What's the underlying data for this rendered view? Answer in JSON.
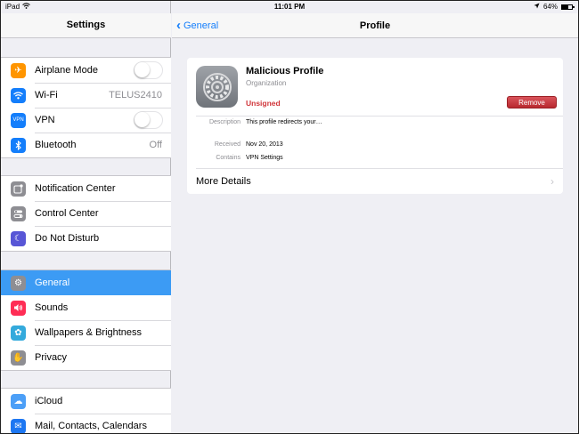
{
  "status_bar": {
    "device": "iPad",
    "time": "11:01 PM",
    "battery": "64%",
    "battery_level": 0.64
  },
  "sidebar": {
    "title": "Settings",
    "groups": [
      [
        {
          "label": "Airplane Mode",
          "icon": "airplane-icon",
          "color": "#ff9500",
          "accessory": "toggle"
        },
        {
          "label": "Wi-Fi",
          "icon": "wifi-icon",
          "color": "#147efb",
          "value": "TELUS2410"
        },
        {
          "label": "VPN",
          "icon": "vpn-icon",
          "color": "#147efb",
          "icon_text": "VPN",
          "accessory": "toggle"
        },
        {
          "label": "Bluetooth",
          "icon": "bluetooth-icon",
          "color": "#147efb",
          "value": "Off"
        }
      ],
      [
        {
          "label": "Notification Center",
          "icon": "notification-center-icon",
          "color": "#8e8e93"
        },
        {
          "label": "Control Center",
          "icon": "control-center-icon",
          "color": "#8e8e93"
        },
        {
          "label": "Do Not Disturb",
          "icon": "moon-icon",
          "color": "#5856d6"
        }
      ],
      [
        {
          "label": "General",
          "icon": "gear-icon",
          "color": "#8e8e93",
          "selected": true
        },
        {
          "label": "Sounds",
          "icon": "speaker-icon",
          "color": "#ff2d55"
        },
        {
          "label": "Wallpapers & Brightness",
          "icon": "wallpaper-icon",
          "color": "#34aadc"
        },
        {
          "label": "Privacy",
          "icon": "hand-icon",
          "color": "#8e8e93"
        }
      ],
      [
        {
          "label": "iCloud",
          "icon": "cloud-icon",
          "color": "#4c9ff7"
        },
        {
          "label": "Mail, Contacts, Calendars",
          "icon": "mail-icon",
          "color": "#1d77f2"
        }
      ]
    ]
  },
  "detail": {
    "back_label": "General",
    "title": "Profile",
    "profile": {
      "name": "Malicious Profile",
      "organization": "Organization",
      "status": "Unsigned",
      "remove_label": "Remove",
      "fields": [
        {
          "label": "Description",
          "value": "This profile redirects your…"
        },
        {
          "label": "Received",
          "value": "Nov 20, 2013"
        },
        {
          "label": "Contains",
          "value": "VPN Settings"
        }
      ],
      "more_details_label": "More Details"
    }
  }
}
